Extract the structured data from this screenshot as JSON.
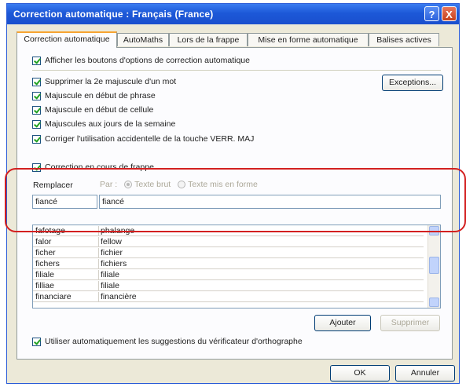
{
  "window": {
    "title": "Correction automatique : Français (France)",
    "help_label": "?",
    "close_label": "X"
  },
  "tabs": [
    {
      "label": "Correction automatique",
      "active": true
    },
    {
      "label": "AutoMaths",
      "active": false
    },
    {
      "label": "Lors de la frappe",
      "active": false
    },
    {
      "label": "Mise en forme automatique",
      "active": false
    },
    {
      "label": "Balises actives",
      "active": false
    }
  ],
  "options": {
    "show_buttons": "Afficher les boutons d'options de correction automatique",
    "two_initial_caps": "Supprimer la 2e majuscule d'un mot",
    "capitalize_sentence": "Majuscule en début de phrase",
    "capitalize_cell": "Majuscule en début de cellule",
    "capitalize_days": "Majuscules aux jours de la semaine",
    "caps_lock": "Corriger l'utilisation accidentelle de la touche VERR. MAJ",
    "replace_typing": "Correction en cours de frappe",
    "use_suggestions": "Utiliser automatiquement les suggestions du vérificateur d'orthographe"
  },
  "buttons": {
    "exceptions": "Exceptions...",
    "add": "Ajouter",
    "delete": "Supprimer",
    "ok": "OK",
    "cancel": "Annuler"
  },
  "replace": {
    "replace_label": "Remplacer",
    "by_label": "Par :",
    "plain_text": "Texte brut",
    "formatted_text": "Texte mis en forme",
    "replace_value": "fiancé",
    "with_value": "fiancé"
  },
  "list": {
    "rows": [
      {
        "from": "fafotage",
        "to": "phalange"
      },
      {
        "from": "falor",
        "to": "fellow"
      },
      {
        "from": "ficher",
        "to": "fichier"
      },
      {
        "from": "fichers",
        "to": "fichiers"
      },
      {
        "from": "filiale",
        "to": "filiale"
      },
      {
        "from": "filliae",
        "to": "filiale"
      },
      {
        "from": "financiare",
        "to": "financière"
      }
    ]
  }
}
